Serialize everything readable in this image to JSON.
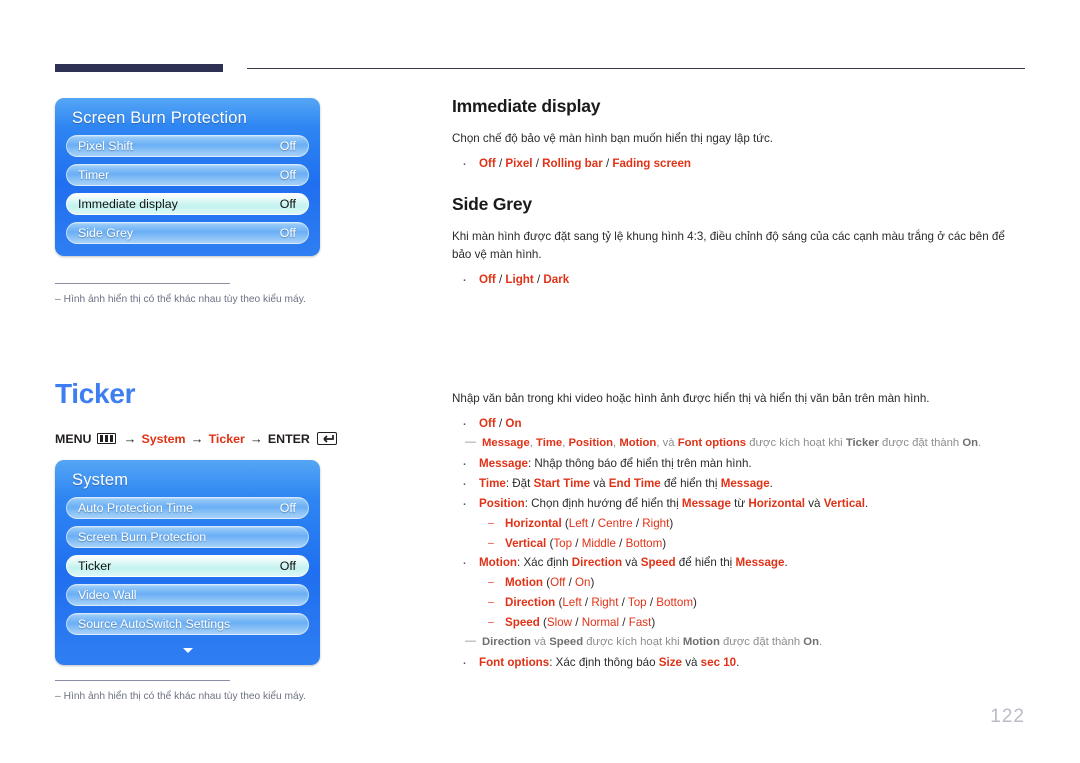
{
  "page": {
    "number": "122"
  },
  "header": {
    "accent_color": "#2d3254",
    "rule_color": "#3a3a4a"
  },
  "osd_panels": [
    {
      "id": "screen-burn",
      "title": "Screen Burn Protection",
      "has_up_arrow": false,
      "has_down_arrow": false,
      "rows": [
        {
          "label": "Pixel Shift",
          "value": "Off",
          "selected": false
        },
        {
          "label": "Timer",
          "value": "Off",
          "selected": false
        },
        {
          "label": "Immediate display",
          "value": "Off",
          "selected": true
        },
        {
          "label": "Side Grey",
          "value": "Off",
          "selected": false
        }
      ]
    },
    {
      "id": "system",
      "title": "System",
      "has_up_arrow": true,
      "has_down_arrow": true,
      "rows": [
        {
          "label": "Auto Protection Time",
          "value": "Off",
          "selected": false
        },
        {
          "label": "Screen Burn Protection",
          "value": "",
          "selected": false
        },
        {
          "label": "Ticker",
          "value": "Off",
          "selected": true
        },
        {
          "label": "Video Wall",
          "value": "",
          "selected": false
        },
        {
          "label": "Source AutoSwitch Settings",
          "value": "",
          "selected": false
        }
      ]
    }
  ],
  "panel_notes": [
    {
      "dash": "–",
      "text": "Hình ảnh hiển thị có thể khác nhau tùy theo kiểu máy."
    },
    {
      "dash": "–",
      "text": "Hình ảnh hiển thị có thể khác nhau tùy theo kiểu máy."
    }
  ],
  "ticker_heading": "Ticker",
  "menu_path": {
    "menu_label": "MENU",
    "menu_icon": "menu-bars-icon",
    "arrow1": "→",
    "item1": "System",
    "arrow2": "→",
    "item2": "Ticker",
    "arrow3": "→",
    "enter_label": "ENTER",
    "enter_icon": "enter-return-icon"
  },
  "sections": {
    "immediate_display": {
      "heading": "Immediate display",
      "paragraph": "Chọn chế độ bảo vệ màn hình bạn muốn hiển thị ngay lập tức.",
      "options_line": {
        "p1": "Off",
        "s1": " / ",
        "p2": "Pixel",
        "s2": " / ",
        "p3": "Rolling bar",
        "s3": " / ",
        "p4": "Fading screen"
      }
    },
    "side_grey": {
      "heading": "Side Grey",
      "paragraph": "Khi màn hình được đặt sang tỷ lệ khung hình 4:3, điều chỉnh độ sáng của các cạnh màu trắng ở các bên để bảo vệ màn hình.",
      "options_line": {
        "p1": "Off",
        "s1": " / ",
        "p2": "Light",
        "s2": " / ",
        "p3": "Dark"
      }
    }
  },
  "ticker": {
    "intro": "Nhập văn bản trong khi video hoặc hình ảnh được hiển thị và hiển thị văn bản trên màn hình.",
    "onoff": {
      "p1": "Off",
      "s1": " / ",
      "p2": "On"
    },
    "note1": {
      "t1": "Message",
      "t1s": ", ",
      "t2": "Time",
      "t2s": ", ",
      "t3": "Position",
      "t3s": ", ",
      "t4": "Motion",
      "t4s": ", và ",
      "t5": "Font options",
      "mid": " được kích hoạt khi ",
      "t6": "Ticker",
      "mid2": " được đặt thành ",
      "t7": "On",
      "end": "."
    },
    "message": {
      "term": "Message",
      "rest": ": Nhập thông báo để hiển thị trên màn hình."
    },
    "time": {
      "term": "Time",
      "a": ": Đặt ",
      "t1": "Start Time",
      "b": " và ",
      "t2": "End Time",
      "c": " để hiển thị ",
      "t3": "Message",
      "d": "."
    },
    "position": {
      "term": "Position",
      "a": ": Chọn định hướng để hiển thị ",
      "t1": "Message",
      "b": " từ ",
      "t2": "Horizontal",
      "c": " và ",
      "t3": "Vertical",
      "d": "."
    },
    "horizontal": {
      "term": "Horizontal",
      "open": " (",
      "o1": "Left",
      "s1": " / ",
      "o2": "Centre",
      "s2": " / ",
      "o3": "Right",
      "close": ")"
    },
    "vertical": {
      "term": "Vertical",
      "open": " (",
      "o1": "Top",
      "s1": " / ",
      "o2": "Middle",
      "s2": " / ",
      "o3": "Bottom",
      "close": ")"
    },
    "motion": {
      "term": "Motion",
      "a": ": Xác định ",
      "t1": "Direction",
      "b": " và ",
      "t2": "Speed",
      "c": " để hiển thị ",
      "t3": "Message",
      "d": "."
    },
    "motion_sub": {
      "term": "Motion",
      "open": " (",
      "o1": "Off",
      "s1": " / ",
      "o2": "On",
      "s2": "",
      "o3": "",
      "close": ")"
    },
    "direction_sub": {
      "term": "Direction",
      "open": " (",
      "o1": "Left",
      "s1": " / ",
      "o2": "Right",
      "s2": " / ",
      "o3": "Top",
      "s3": " / ",
      "o4": "Bottom",
      "close": ")"
    },
    "speed_sub": {
      "term": "Speed",
      "open": " (",
      "o1": "Slow",
      "s1": " / ",
      "o2": "Normal",
      "s2": " / ",
      "o3": "Fast",
      "close": ")"
    },
    "note2": {
      "t1": "Direction",
      "mid1": " và ",
      "t2": "Speed",
      "mid2": " được kích hoạt khi ",
      "t3": "Motion",
      "mid3": " được đặt thành ",
      "t4": "On",
      "end": "."
    },
    "font_options": {
      "term": "Font options",
      "a": ": Xác định thông báo ",
      "t1": "Size",
      "b": " và ",
      "t2": "sec 10",
      "c": "."
    }
  }
}
